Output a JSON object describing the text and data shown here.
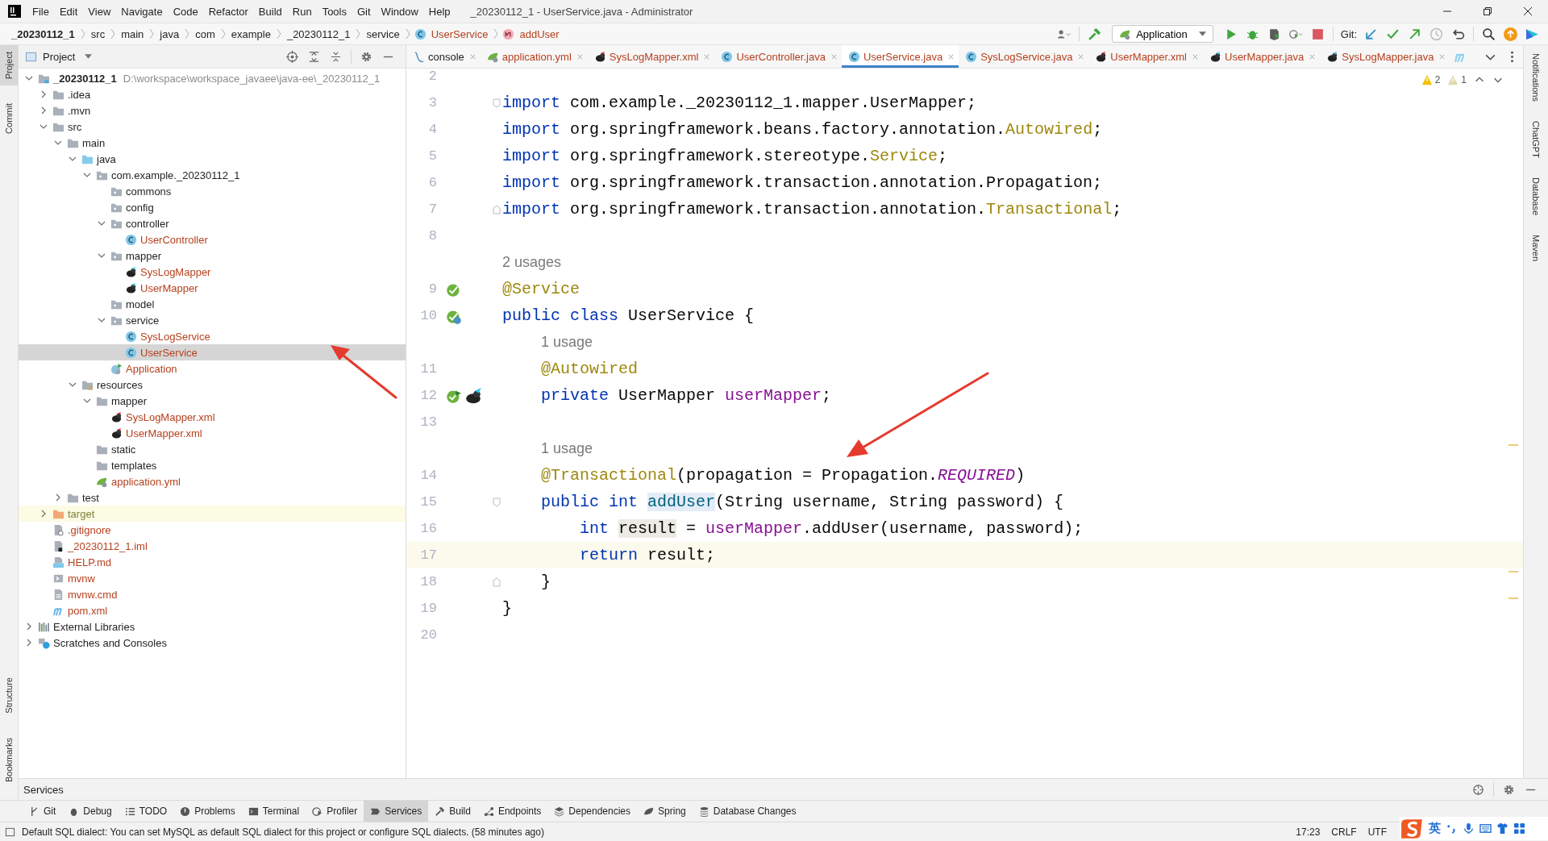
{
  "window": {
    "title": "_20230112_1 - UserService.java - Administrator"
  },
  "menu": [
    "File",
    "Edit",
    "View",
    "Navigate",
    "Code",
    "Refactor",
    "Build",
    "Run",
    "Tools",
    "Git",
    "Window",
    "Help"
  ],
  "breadcrumbs": [
    {
      "label": "_20230112_1",
      "kind": "project"
    },
    {
      "label": "src",
      "kind": "dir"
    },
    {
      "label": "main",
      "kind": "dir"
    },
    {
      "label": "java",
      "kind": "dir"
    },
    {
      "label": "com",
      "kind": "dir"
    },
    {
      "label": "example",
      "kind": "dir"
    },
    {
      "label": "_20230112_1",
      "kind": "dir"
    },
    {
      "label": "service",
      "kind": "dir"
    },
    {
      "label": "UserService",
      "kind": "class"
    },
    {
      "label": "addUser",
      "kind": "method"
    }
  ],
  "toolbar": {
    "run_config": "Application",
    "git_label": "Git:"
  },
  "left_stripe_top": [
    {
      "label": "Project",
      "selected": true
    },
    {
      "label": "Commit",
      "selected": false
    }
  ],
  "left_stripe_bottom": [
    {
      "label": "Structure",
      "selected": false
    },
    {
      "label": "Bookmarks",
      "selected": false
    }
  ],
  "right_stripe": [
    {
      "label": "Notifications"
    },
    {
      "label": "ChatGPT"
    },
    {
      "label": "Database"
    },
    {
      "label": "Maven"
    }
  ],
  "project_panel": {
    "title": "Project",
    "tree": [
      {
        "label": "_20230112_1",
        "kind": "project",
        "detail": "D:\\workspace\\workspace_javaee\\java-ee\\_20230112_1",
        "expanded": true,
        "selected": false,
        "unversioned": false,
        "ignored": false,
        "children": [
          {
            "label": ".idea",
            "kind": "folder",
            "expanded": false,
            "selected": false,
            "unversioned": false,
            "ignored": false
          },
          {
            "label": ".mvn",
            "kind": "folder",
            "expanded": false,
            "selected": false,
            "unversioned": false,
            "ignored": false
          },
          {
            "label": "src",
            "kind": "folder",
            "expanded": true,
            "selected": false,
            "unversioned": false,
            "ignored": false,
            "children": [
              {
                "label": "main",
                "kind": "folder",
                "expanded": true,
                "selected": false,
                "unversioned": false,
                "ignored": false,
                "children": [
                  {
                    "label": "java",
                    "kind": "source-folder",
                    "expanded": true,
                    "selected": false,
                    "unversioned": false,
                    "ignored": false,
                    "children": [
                      {
                        "label": "com.example._20230112_1",
                        "kind": "package",
                        "expanded": true,
                        "selected": false,
                        "unversioned": false,
                        "ignored": false,
                        "children": [
                          {
                            "label": "commons",
                            "kind": "package",
                            "selected": false,
                            "unversioned": false,
                            "ignored": false
                          },
                          {
                            "label": "config",
                            "kind": "package",
                            "selected": false,
                            "unversioned": false,
                            "ignored": false
                          },
                          {
                            "label": "controller",
                            "kind": "package",
                            "expanded": true,
                            "selected": false,
                            "unversioned": false,
                            "ignored": false,
                            "children": [
                              {
                                "label": "UserController",
                                "kind": "class",
                                "selected": false,
                                "unversioned": true,
                                "ignored": false
                              }
                            ]
                          },
                          {
                            "label": "mapper",
                            "kind": "package",
                            "expanded": true,
                            "selected": false,
                            "unversioned": false,
                            "ignored": false,
                            "children": [
                              {
                                "label": "SysLogMapper",
                                "kind": "mybatis",
                                "selected": false,
                                "unversioned": true,
                                "ignored": false
                              },
                              {
                                "label": "UserMapper",
                                "kind": "mybatis",
                                "selected": false,
                                "unversioned": true,
                                "ignored": false
                              }
                            ]
                          },
                          {
                            "label": "model",
                            "kind": "package",
                            "selected": false,
                            "unversioned": false,
                            "ignored": false
                          },
                          {
                            "label": "service",
                            "kind": "package",
                            "expanded": true,
                            "selected": false,
                            "unversioned": false,
                            "ignored": false,
                            "children": [
                              {
                                "label": "SysLogService",
                                "kind": "class",
                                "selected": false,
                                "unversioned": true,
                                "ignored": false
                              },
                              {
                                "label": "UserService",
                                "kind": "class",
                                "selected": true,
                                "unversioned": true,
                                "ignored": false
                              }
                            ]
                          },
                          {
                            "label": "Application",
                            "kind": "spring-app",
                            "selected": false,
                            "unversioned": true,
                            "ignored": false
                          }
                        ]
                      }
                    ]
                  },
                  {
                    "label": "resources",
                    "kind": "resources-folder",
                    "expanded": true,
                    "selected": false,
                    "unversioned": false,
                    "ignored": false,
                    "children": [
                      {
                        "label": "mapper",
                        "kind": "folder",
                        "expanded": true,
                        "selected": false,
                        "unversioned": false,
                        "ignored": false,
                        "children": [
                          {
                            "label": "SysLogMapper.xml",
                            "kind": "mybatis-xml",
                            "selected": false,
                            "unversioned": true,
                            "ignored": false
                          },
                          {
                            "label": "UserMapper.xml",
                            "kind": "mybatis-xml",
                            "selected": false,
                            "unversioned": true,
                            "ignored": false
                          }
                        ]
                      },
                      {
                        "label": "static",
                        "kind": "folder",
                        "selected": false,
                        "unversioned": false,
                        "ignored": false
                      },
                      {
                        "label": "templates",
                        "kind": "folder",
                        "selected": false,
                        "unversioned": false,
                        "ignored": false
                      },
                      {
                        "label": "application.yml",
                        "kind": "yml",
                        "selected": false,
                        "unversioned": true,
                        "ignored": false
                      }
                    ]
                  }
                ]
              },
              {
                "label": "test",
                "kind": "folder",
                "expanded": false,
                "selected": false,
                "unversioned": false,
                "ignored": false
              }
            ]
          },
          {
            "label": "target",
            "kind": "excluded-folder",
            "expanded": false,
            "selected": false,
            "unversioned": false,
            "ignored": true
          },
          {
            "label": ".gitignore",
            "kind": "ignore-file",
            "selected": false,
            "unversioned": true,
            "ignored": false
          },
          {
            "label": "_20230112_1.iml",
            "kind": "module-file",
            "selected": false,
            "unversioned": true,
            "ignored": false
          },
          {
            "label": "HELP.md",
            "kind": "markdown",
            "selected": false,
            "unversioned": true,
            "ignored": false
          },
          {
            "label": "mvnw",
            "kind": "script",
            "selected": false,
            "unversioned": true,
            "ignored": false
          },
          {
            "label": "mvnw.cmd",
            "kind": "text-file",
            "selected": false,
            "unversioned": true,
            "ignored": false
          },
          {
            "label": "pom.xml",
            "kind": "maven",
            "selected": false,
            "unversioned": true,
            "ignored": false
          }
        ]
      },
      {
        "label": "External Libraries",
        "kind": "libraries",
        "expanded": false,
        "selected": false,
        "unversioned": false,
        "ignored": false
      },
      {
        "label": "Scratches and Consoles",
        "kind": "scratches",
        "expanded": false,
        "selected": false,
        "unversioned": false,
        "ignored": false
      }
    ]
  },
  "tabs": [
    {
      "label": "console",
      "kind": "console",
      "selected": false,
      "unversioned": false
    },
    {
      "label": "application.yml",
      "kind": "yml",
      "selected": false,
      "unversioned": true
    },
    {
      "label": "SysLogMapper.xml",
      "kind": "mybatis-xml",
      "selected": false,
      "unversioned": true
    },
    {
      "label": "UserController.java",
      "kind": "class",
      "selected": false,
      "unversioned": true
    },
    {
      "label": "UserService.java",
      "kind": "class",
      "selected": true,
      "unversioned": true
    },
    {
      "label": "SysLogService.java",
      "kind": "class",
      "selected": false,
      "unversioned": true
    },
    {
      "label": "UserMapper.xml",
      "kind": "mybatis-xml",
      "selected": false,
      "unversioned": true
    },
    {
      "label": "UserMapper.java",
      "kind": "mybatis",
      "selected": false,
      "unversioned": true
    },
    {
      "label": "SysLogMapper.java",
      "kind": "mybatis",
      "selected": false,
      "unversioned": true
    }
  ],
  "inspections": {
    "warnings": "2",
    "weak_warnings": "1"
  },
  "editor": {
    "lines": [
      {
        "kind": "code",
        "number": "2",
        "current": false,
        "fold_start": false,
        "fold_end": false
      },
      {
        "kind": "code",
        "number": "3",
        "current": false,
        "fold_start": true,
        "fold_end": false,
        "tokens": [
          {
            "text": "import",
            "kind": "keyword"
          },
          {
            "text": " com.example._20230112_1.mapper.UserMapper;",
            "kind": "plain"
          }
        ]
      },
      {
        "kind": "code",
        "number": "4",
        "current": false,
        "fold_start": false,
        "fold_end": false,
        "tokens": [
          {
            "text": "import",
            "kind": "keyword"
          },
          {
            "text": " org.springframework.beans.factory.annotation.",
            "kind": "plain"
          },
          {
            "text": "Autowired",
            "kind": "annotation"
          },
          {
            "text": ";",
            "kind": "plain"
          }
        ]
      },
      {
        "kind": "code",
        "number": "5",
        "current": false,
        "fold_start": false,
        "fold_end": false,
        "tokens": [
          {
            "text": "import",
            "kind": "keyword"
          },
          {
            "text": " org.springframework.stereotype.",
            "kind": "plain"
          },
          {
            "text": "Service",
            "kind": "annotation"
          },
          {
            "text": ";",
            "kind": "plain"
          }
        ]
      },
      {
        "kind": "code",
        "number": "6",
        "current": false,
        "fold_start": false,
        "fold_end": false,
        "tokens": [
          {
            "text": "import",
            "kind": "keyword"
          },
          {
            "text": " org.springframework.transaction.annotation.Propagation;",
            "kind": "plain"
          }
        ]
      },
      {
        "kind": "code",
        "number": "7",
        "current": false,
        "fold_start": false,
        "fold_end": true,
        "tokens": [
          {
            "text": "import",
            "kind": "keyword"
          },
          {
            "text": " org.springframework.transaction.annotation.",
            "kind": "plain"
          },
          {
            "text": "Transactional",
            "kind": "annotation"
          },
          {
            "text": ";",
            "kind": "plain"
          }
        ]
      },
      {
        "kind": "code",
        "number": "8",
        "current": false,
        "fold_start": false,
        "fold_end": false
      },
      {
        "kind": "hint",
        "indented": false,
        "text": "2 usages"
      },
      {
        "kind": "code",
        "number": "9",
        "current": false,
        "fold_start": false,
        "fold_end": false,
        "gutter": [
          {
            "kind": "bean"
          }
        ],
        "tokens": [
          {
            "text": "@Service",
            "kind": "annotation"
          }
        ]
      },
      {
        "kind": "code",
        "number": "10",
        "current": false,
        "fold_start": false,
        "fold_end": false,
        "gutter": [
          {
            "kind": "bean-class"
          }
        ],
        "tokens": [
          {
            "text": "public class",
            "kind": "keyword"
          },
          {
            "text": " UserService {",
            "kind": "plain"
          }
        ]
      },
      {
        "kind": "hint",
        "indented": true,
        "text": "1 usage"
      },
      {
        "kind": "code",
        "number": "11",
        "current": false,
        "fold_start": false,
        "fold_end": false,
        "tokens": [
          {
            "text": "    @Autowired",
            "kind": "annotation"
          }
        ]
      },
      {
        "kind": "code",
        "number": "12",
        "current": false,
        "fold_start": false,
        "fold_end": false,
        "gutter": [
          {
            "kind": "bean-inject"
          },
          {
            "kind": "mybatis"
          }
        ],
        "tokens": [
          {
            "text": "    private",
            "kind": "keyword"
          },
          {
            "text": " UserMapper ",
            "kind": "plain"
          },
          {
            "text": "userMapper",
            "kind": "field"
          },
          {
            "text": ";",
            "kind": "plain"
          }
        ]
      },
      {
        "kind": "code",
        "number": "13",
        "current": false,
        "fold_start": false,
        "fold_end": false
      },
      {
        "kind": "hint",
        "indented": true,
        "text": "1 usage"
      },
      {
        "kind": "code",
        "number": "14",
        "current": false,
        "fold_start": false,
        "fold_end": false,
        "tokens": [
          {
            "text": "    @Transactional",
            "kind": "annotation"
          },
          {
            "text": "(propagation = Propagation.",
            "kind": "plain"
          },
          {
            "text": "REQUIRED",
            "kind": "constant"
          },
          {
            "text": ")",
            "kind": "plain"
          }
        ]
      },
      {
        "kind": "code",
        "number": "15",
        "current": false,
        "fold_start": true,
        "fold_end": false,
        "tokens": [
          {
            "text": "    public int ",
            "kind": "keyword"
          },
          {
            "text": "addUser",
            "kind": "declaration"
          },
          {
            "text": "(String username, String password) {",
            "kind": "plain"
          }
        ]
      },
      {
        "kind": "code",
        "number": "16",
        "current": false,
        "fold_start": false,
        "fold_end": false,
        "tokens": [
          {
            "text": "        int ",
            "kind": "keyword"
          },
          {
            "text": "result",
            "kind": "highlighted"
          },
          {
            "text": " = ",
            "kind": "plain"
          },
          {
            "text": "userMapper",
            "kind": "field"
          },
          {
            "text": ".addUser(username, password);",
            "kind": "plain"
          }
        ]
      },
      {
        "kind": "code",
        "number": "17",
        "current": true,
        "fold_start": false,
        "fold_end": false,
        "tokens": [
          {
            "text": "        return",
            "kind": "keyword"
          },
          {
            "text": " result;",
            "kind": "plain"
          }
        ]
      },
      {
        "kind": "code",
        "number": "18",
        "current": false,
        "fold_start": false,
        "fold_end": true,
        "tokens": [
          {
            "text": "    }",
            "kind": "plain"
          }
        ]
      },
      {
        "kind": "code",
        "number": "19",
        "current": false,
        "fold_start": false,
        "fold_end": false,
        "tokens": [
          {
            "text": "}",
            "kind": "plain"
          }
        ]
      },
      {
        "kind": "code",
        "number": "20",
        "current": false,
        "fold_start": false,
        "fold_end": false
      }
    ]
  },
  "services_panel": {
    "title": "Services"
  },
  "bottom_tabs": [
    {
      "label": "Git",
      "kind": "git",
      "selected": false
    },
    {
      "label": "Debug",
      "kind": "debug",
      "selected": false
    },
    {
      "label": "TODO",
      "kind": "todo",
      "selected": false
    },
    {
      "label": "Problems",
      "kind": "problems",
      "selected": false
    },
    {
      "label": "Terminal",
      "kind": "terminal",
      "selected": false
    },
    {
      "label": "Profiler",
      "kind": "profiler",
      "selected": false
    },
    {
      "label": "Services",
      "kind": "services",
      "selected": true
    },
    {
      "label": "Build",
      "kind": "build",
      "selected": false
    },
    {
      "label": "Endpoints",
      "kind": "endpoints",
      "selected": false
    },
    {
      "label": "Dependencies",
      "kind": "dependencies",
      "selected": false
    },
    {
      "label": "Spring",
      "kind": "spring",
      "selected": false
    },
    {
      "label": "Database Changes",
      "kind": "database",
      "selected": false
    }
  ],
  "status_bar": {
    "message": "Default SQL dialect: You can set MySQL as default SQL dialect for this project or configure SQL dialects. (58 minutes ago)",
    "position": "17:23",
    "line_separator": "CRLF",
    "encoding": "UTF"
  },
  "ime_bar": {
    "language": "英"
  }
}
